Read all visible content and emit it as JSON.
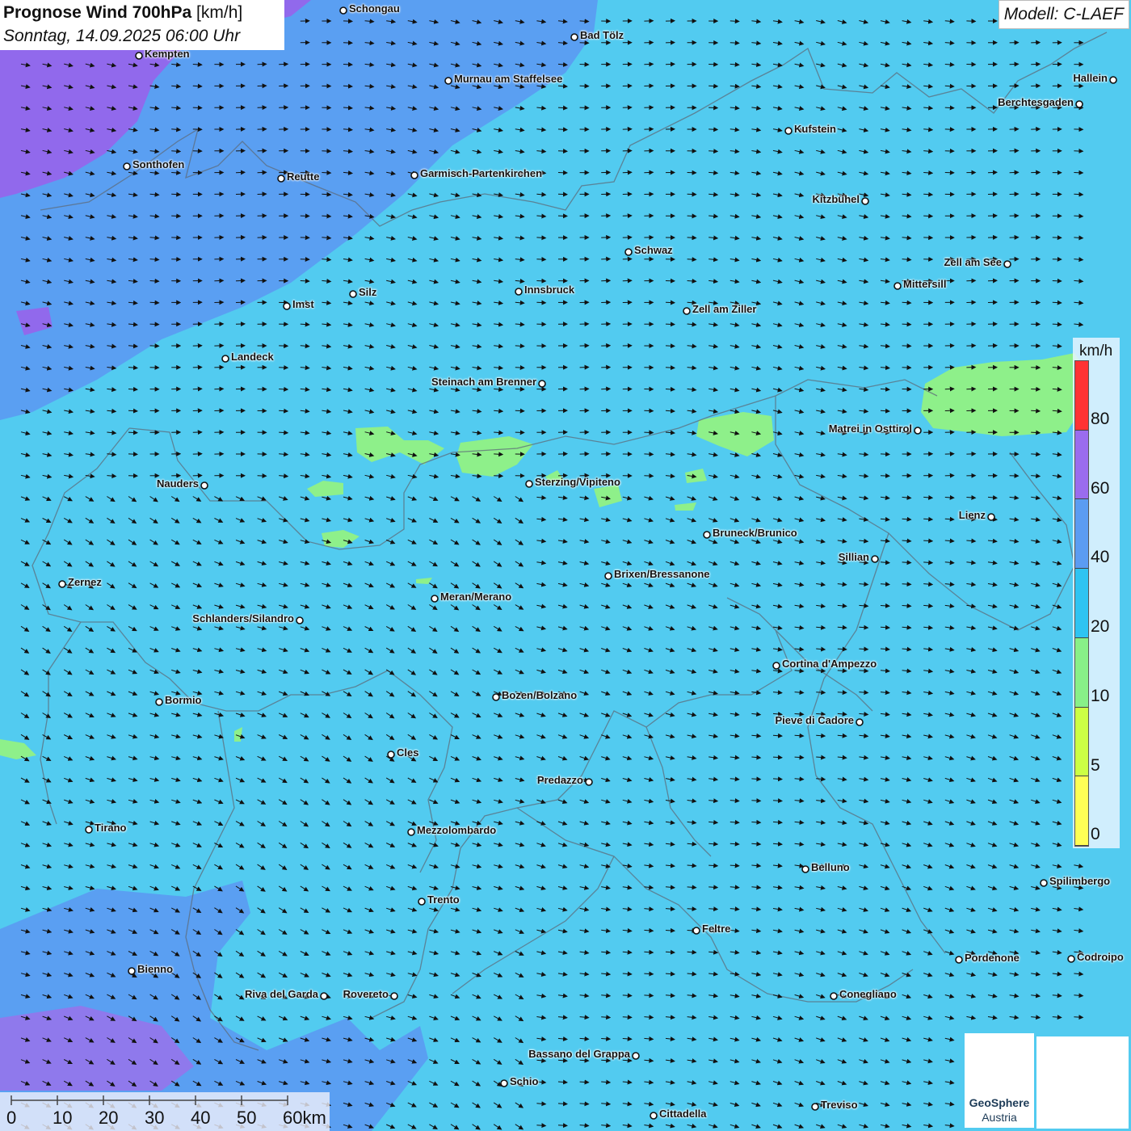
{
  "title": {
    "main_bold": "Prognose Wind 700hPa",
    "unit": "[km/h]",
    "datetime": "Sonntag, 14.09.2025 06:00 Uhr"
  },
  "model_label": "Modell: C-LAEF",
  "legend": {
    "unit": "km/h",
    "ticks": [
      "80",
      "60",
      "40",
      "20",
      "10",
      "5",
      "0"
    ],
    "bands": [
      {
        "from": 0,
        "to": 5,
        "color": "#ffff55"
      },
      {
        "from": 5,
        "to": 10,
        "color": "#ccff44"
      },
      {
        "from": 10,
        "to": 20,
        "color": "#88f088"
      },
      {
        "from": 20,
        "to": 40,
        "color": "#2ec4f2"
      },
      {
        "from": 40,
        "to": 60,
        "color": "#5b9cf2"
      },
      {
        "from": 60,
        "to": 80,
        "color": "#9a6cee"
      },
      {
        "from": 80,
        "to": 100,
        "color": "#ff3333"
      }
    ]
  },
  "cities": [
    {
      "name": "Schongau",
      "label_side": "right"
    },
    {
      "name": "Bad Tölz",
      "label_side": "right"
    },
    {
      "name": "Kempten",
      "label_side": "right"
    },
    {
      "name": "Murnau am Staffelsee",
      "label_side": "right"
    },
    {
      "name": "Hallein",
      "label_side": "left"
    },
    {
      "name": "Berchtesgaden",
      "label_side": "left"
    },
    {
      "name": "Kufstein",
      "label_side": "right"
    },
    {
      "name": "Sonthofen",
      "label_side": "right"
    },
    {
      "name": "Reutte",
      "label_side": "right"
    },
    {
      "name": "Garmisch-Partenkirchen",
      "label_side": "right"
    },
    {
      "name": "Kitzbühel",
      "label_side": "left"
    },
    {
      "name": "Schwaz",
      "label_side": "right"
    },
    {
      "name": "Zell am See",
      "label_side": "left"
    },
    {
      "name": "Mittersill",
      "label_side": "right"
    },
    {
      "name": "Innsbruck",
      "label_side": "right"
    },
    {
      "name": "Silz",
      "label_side": "right"
    },
    {
      "name": "Imst",
      "label_side": "right"
    },
    {
      "name": "Zell am Ziller",
      "label_side": "right"
    },
    {
      "name": "Landeck",
      "label_side": "right"
    },
    {
      "name": "Steinach am Brenner",
      "label_side": "left"
    },
    {
      "name": "Matrei in Osttirol",
      "label_side": "left"
    },
    {
      "name": "Nauders",
      "label_side": "left"
    },
    {
      "name": "Sterzing/Vipiteno",
      "label_side": "right"
    },
    {
      "name": "Lienz",
      "label_side": "left"
    },
    {
      "name": "Bruneck/Brunico",
      "label_side": "right"
    },
    {
      "name": "Sillian",
      "label_side": "left"
    },
    {
      "name": "Zernez",
      "label_side": "right"
    },
    {
      "name": "Brixen/Bressanone",
      "label_side": "right"
    },
    {
      "name": "Meran/Merano",
      "label_side": "right"
    },
    {
      "name": "Schlanders/Silandro",
      "label_side": "left"
    },
    {
      "name": "Cortina d'Ampezzo",
      "label_side": "right"
    },
    {
      "name": "Bozen/Bolzano",
      "label_side": "right"
    },
    {
      "name": "Bormio",
      "label_side": "right"
    },
    {
      "name": "Pieve di Cadore",
      "label_side": "left"
    },
    {
      "name": "Cles",
      "label_side": "right"
    },
    {
      "name": "Predazzo",
      "label_side": "left"
    },
    {
      "name": "Tirano",
      "label_side": "right"
    },
    {
      "name": "Mezzolombardo",
      "label_side": "right"
    },
    {
      "name": "Belluno",
      "label_side": "right"
    },
    {
      "name": "Spilimbergo",
      "label_side": "right"
    },
    {
      "name": "Trento",
      "label_side": "right"
    },
    {
      "name": "Feltre",
      "label_side": "right"
    },
    {
      "name": "Pordenone",
      "label_side": "right"
    },
    {
      "name": "Codroipo",
      "label_side": "right"
    },
    {
      "name": "Bienno",
      "label_side": "right"
    },
    {
      "name": "Riva del Garda",
      "label_side": "left"
    },
    {
      "name": "Rovereto",
      "label_side": "left"
    },
    {
      "name": "Conegliano",
      "label_side": "right"
    },
    {
      "name": "Bassano del Grappa",
      "label_side": "left"
    },
    {
      "name": "Schio",
      "label_side": "right"
    },
    {
      "name": "Treviso",
      "label_side": "right"
    },
    {
      "name": "Cittadella",
      "label_side": "right"
    }
  ],
  "scale_bar": {
    "labels": [
      "0",
      "10",
      "20",
      "30",
      "40",
      "50",
      "60km"
    ]
  },
  "logo": {
    "name_line1": "GeoSphere",
    "name_line2": "Austria"
  }
}
